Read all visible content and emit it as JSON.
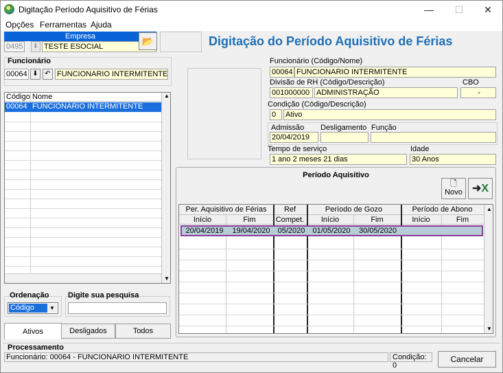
{
  "window": {
    "title": "Digitação Período Aquisitivo de Férias",
    "minimize": "—",
    "maximize": "☐",
    "close": "✕"
  },
  "menu": {
    "opcoes": "Opções",
    "ferramentas": "Ferramentas",
    "ajuda": "Ajuda"
  },
  "empresa": {
    "label": "Empresa",
    "code": "0495",
    "name": "TESTE ESOCIAL"
  },
  "page_title": "Digitação do Período Aquisitivo de Férias",
  "funcionario_filter": {
    "label": "Funcionário",
    "code": "00064",
    "name": "FUNCIONARIO INTERMITENTE"
  },
  "employee_list": {
    "col_code": "Código",
    "col_name": "Nome",
    "rows": [
      {
        "code": "00064",
        "name": "FUNCIONARIO INTERMITENTE"
      }
    ]
  },
  "ordenacao": {
    "label": "Ordenação",
    "value": "Código"
  },
  "pesquisa": {
    "label": "Digite sua pesquisa",
    "value": ""
  },
  "tabs": {
    "ativos": "Ativos",
    "desligados": "Desligados",
    "todos": "Todos"
  },
  "details": {
    "funcionario_label": "Funcionário (Código/Nome)",
    "funcionario_code": "00064",
    "funcionario_name": "FUNCIONARIO INTERMITENTE",
    "divisao_label": "Divisão de RH (Código/Descrição)",
    "divisao_code": "001000000",
    "divisao_desc": "ADMINISTRAÇÃO",
    "cbo_label": "CBO",
    "cbo_value": "-",
    "condicao_label": "Condição (Código/Descrição)",
    "condicao_code": "0",
    "condicao_desc": "Ativo",
    "admissao_label": "Admissão",
    "admissao_value": "20/04/2019",
    "desligamento_label": "Desligamento",
    "desligamento_value": "",
    "funcao_label": "Função",
    "funcao_value": "",
    "tempo_label": "Tempo de serviço",
    "tempo_value": "1 ano 2 meses 21 dias",
    "idade_label": "Idade",
    "idade_value": "30 Anos"
  },
  "periodo": {
    "title": "Período Aquisitivo",
    "novo": "Novo",
    "groups": {
      "per_aquisitivo": "Per. Aquisitivo de Férias",
      "ref": "Ref",
      "gozo": "Período de Gozo",
      "abono": "Período de Abono"
    },
    "subheaders": [
      "Início",
      "Fim",
      "Compet.",
      "Início",
      "Fim",
      "Início",
      "Fim"
    ],
    "rows": [
      [
        "20/04/2019",
        "19/04/2020",
        "05/2020",
        "01/05/2020",
        "30/05/2020",
        "",
        ""
      ]
    ]
  },
  "processamento": {
    "label": "Processamento",
    "status": "Funcionário: 00064 - FUNCIONARIO INTERMITENTE",
    "condicao": "Condição: 0",
    "cancelar": "Cancelar"
  }
}
